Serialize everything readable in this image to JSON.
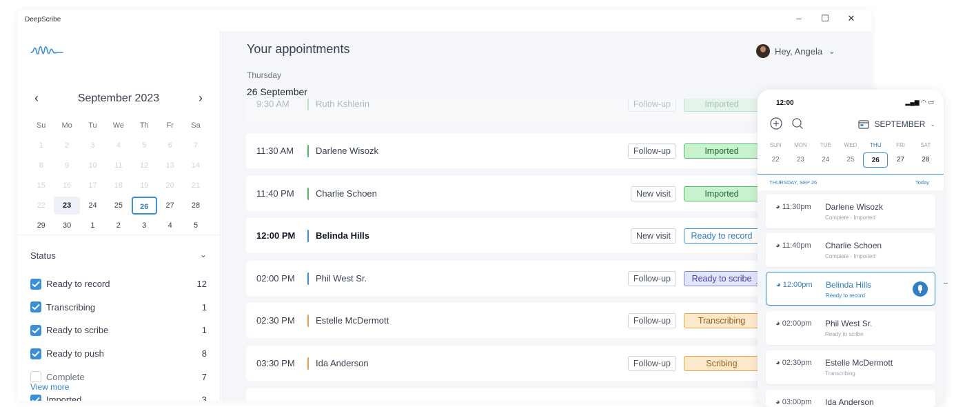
{
  "app": {
    "name": "DeepScribe"
  },
  "window_controls": {
    "minimize": "–",
    "maximize": "☐",
    "close": "✕"
  },
  "calendar": {
    "month_title": "September 2023",
    "prev_icon": "chevron-left-icon",
    "next_icon": "chevron-right-icon",
    "weekdays": [
      "Su",
      "Mo",
      "Tu",
      "We",
      "Th",
      "Fr",
      "Sa"
    ],
    "weeks": [
      [
        "1",
        "2",
        "3",
        "4",
        "5",
        "6",
        "7"
      ],
      [
        "8",
        "9",
        "10",
        "11",
        "12",
        "13",
        "14"
      ],
      [
        "15",
        "16",
        "17",
        "18",
        "19",
        "20",
        "21"
      ],
      [
        "22",
        "23",
        "24",
        "25",
        "26",
        "27",
        "28"
      ],
      [
        "29",
        "30",
        "1",
        "2",
        "3",
        "4",
        "5"
      ]
    ],
    "selected_day": "23",
    "today": "26"
  },
  "status_filter": {
    "title": "Status",
    "items": [
      {
        "label": "Ready to record",
        "count": "12",
        "checked": true
      },
      {
        "label": "Transcribing",
        "count": "1",
        "checked": true
      },
      {
        "label": "Ready to scribe",
        "count": "1",
        "checked": true
      },
      {
        "label": "Ready to push",
        "count": "8",
        "checked": true
      },
      {
        "label": "Complete",
        "count": "7",
        "checked": false
      },
      {
        "label": "Imported",
        "count": "3",
        "checked": true
      }
    ],
    "view_more": "View more"
  },
  "main": {
    "title": "Your appointments",
    "user_greeting": "Hey, Angela",
    "day_name": "Thursday",
    "day_date": "26 September",
    "appointments": [
      {
        "time": "9:30 AM",
        "name": "Ruth Kshlerin",
        "visit": "Follow-up",
        "status": "Imported",
        "status_class": "st-imported",
        "bar_color": "#52b865",
        "faded": true
      },
      {
        "time": "11:30 AM",
        "name": "Darlene Wisozk",
        "visit": "Follow-up",
        "status": "Imported",
        "status_class": "st-imported",
        "bar_color": "#52b865"
      },
      {
        "time": "11:40 PM",
        "name": "Charlie Schoen",
        "visit": "New visit",
        "status": "Imported",
        "status_class": "st-imported",
        "bar_color": "#52b865"
      },
      {
        "time": "12:00 PM",
        "name": "Belinda Hills",
        "visit": "New visit",
        "status": "Ready to record",
        "status_class": "st-record",
        "bar_color": "#3b8fd8",
        "selected": true
      },
      {
        "time": "02:00 PM",
        "name": "Phil West Sr.",
        "visit": "Follow-up",
        "status": "Ready to scribe",
        "status_class": "st-scribe",
        "bar_color": "#3b8fd8"
      },
      {
        "time": "02:30 PM",
        "name": "Estelle McDermott",
        "visit": "Follow-up",
        "status": "Transcribing",
        "status_class": "st-trans",
        "bar_color": "#e6a24a"
      },
      {
        "time": "03:30 PM",
        "name": "Ida Anderson",
        "visit": "Follow-up",
        "status": "Scribing",
        "status_class": "st-trans",
        "bar_color": "#e6a24a"
      }
    ]
  },
  "phone": {
    "clock": "12:00",
    "signal_icons": "signal-wifi-battery-icon",
    "month": "SEPTEMBER",
    "week_days": [
      "SUN",
      "MON",
      "TUE",
      "WED",
      "THU",
      "FRI",
      "SAT"
    ],
    "week_dates": [
      "22",
      "23",
      "24",
      "25",
      "26",
      "27",
      "28"
    ],
    "active_index": 4,
    "section_label": "THURSDAY, SEP 26",
    "today_label": "Today",
    "cards": [
      {
        "time": "11:30pm",
        "name": "Darlene Wisozk",
        "status": "Complete - Imported"
      },
      {
        "time": "11:40pm",
        "name": "Charlie Schoen",
        "status": "Complete - Imported"
      },
      {
        "time": "12:00pm",
        "name": "Belinda Hills",
        "status": "Ready to record",
        "selected": true
      },
      {
        "time": "02:00pm",
        "name": "Phil West Sr.",
        "status": "Ready to scribe"
      },
      {
        "time": "02:30pm",
        "name": "Estelle McDermott",
        "status": "Transcribing"
      },
      {
        "time": "03:00pm",
        "name": "Ida Anderson",
        "status": ""
      }
    ]
  }
}
